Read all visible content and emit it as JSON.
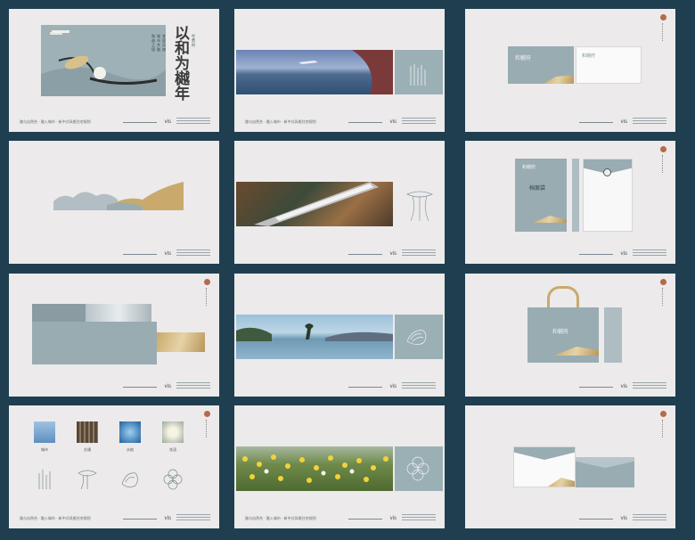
{
  "footer": {
    "tagline": "路与自然合 · 融入城市 · 新中式风格住宅规划",
    "vis_label": "vis"
  },
  "brand": {
    "logo_text": "和樾府",
    "slogan_chars": [
      "以",
      "和",
      "为",
      "樾",
      "年"
    ],
    "slogan_small": [
      "世",
      "贯",
      "时"
    ],
    "poem_lines": [
      "和谐之境",
      "城市共融",
      "宜居风貌"
    ]
  },
  "stationery": {
    "folder_label": "档案袋"
  },
  "gallery_labels": [
    "城市",
    "交通",
    "水韵",
    "花语"
  ],
  "colors": {
    "background": "#1f3f51",
    "card": "#eceaeb",
    "teal": "#98acb2",
    "gold": "#c9aa6c",
    "seal": "#b56a4a"
  }
}
